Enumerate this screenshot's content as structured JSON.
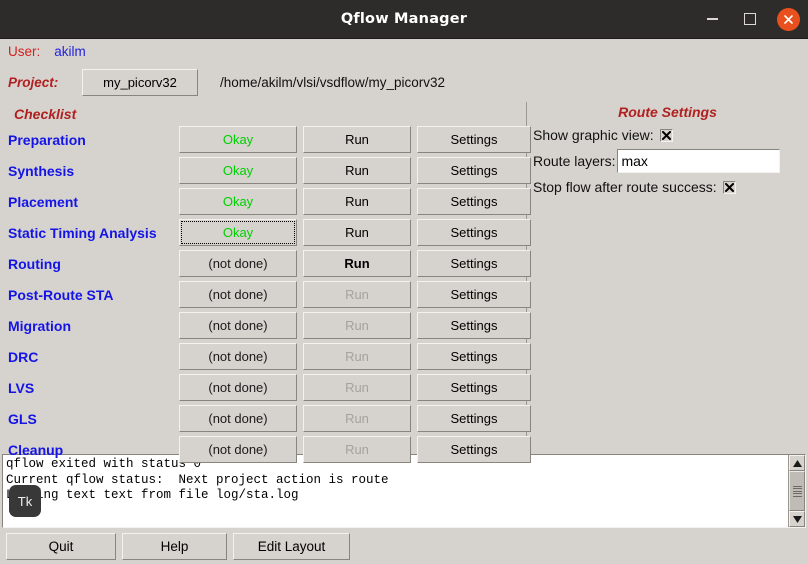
{
  "window": {
    "title": "Qflow Manager",
    "controls": {
      "minimize": "minimize-button",
      "maximize": "maximize-button",
      "close": "close-button"
    },
    "close_color": "#e8501d",
    "titlebar_color": "#2e2c2b"
  },
  "header": {
    "user_label": "User:",
    "user_value": "akilm",
    "project_label": "Project:",
    "project_button": "my_picorv32",
    "project_path": "/home/akilm/vlsi/vsdflow/my_picorv32"
  },
  "checklist": {
    "title": "Checklist",
    "run_label": "Run",
    "settings_label": "Settings",
    "status_okay": "Okay",
    "status_notdone": "(not done)",
    "okay_color": "#00d000",
    "label_color": "#1414e6",
    "rows": [
      {
        "label": "Preparation",
        "status": "Okay",
        "status_state": "okay",
        "run_state": "enabled",
        "settings_state": "enabled",
        "focused": false
      },
      {
        "label": "Synthesis",
        "status": "Okay",
        "status_state": "okay",
        "run_state": "enabled",
        "settings_state": "enabled",
        "focused": false
      },
      {
        "label": "Placement",
        "status": "Okay",
        "status_state": "okay",
        "run_state": "enabled",
        "settings_state": "enabled",
        "focused": false
      },
      {
        "label": "Static Timing Analysis",
        "status": "Okay",
        "status_state": "okay",
        "run_state": "enabled",
        "settings_state": "enabled",
        "focused": true
      },
      {
        "label": "Routing",
        "status": "(not done)",
        "status_state": "not-done",
        "run_state": "active",
        "settings_state": "enabled",
        "focused": false
      },
      {
        "label": "Post-Route STA",
        "status": "(not done)",
        "status_state": "not-done",
        "run_state": "disabled",
        "settings_state": "enabled",
        "focused": false
      },
      {
        "label": "Migration",
        "status": "(not done)",
        "status_state": "not-done",
        "run_state": "disabled",
        "settings_state": "enabled",
        "focused": false
      },
      {
        "label": "DRC",
        "status": "(not done)",
        "status_state": "not-done",
        "run_state": "disabled",
        "settings_state": "enabled",
        "focused": false
      },
      {
        "label": "LVS",
        "status": "(not done)",
        "status_state": "not-done",
        "run_state": "disabled",
        "settings_state": "enabled",
        "focused": false
      },
      {
        "label": "GLS",
        "status": "(not done)",
        "status_state": "not-done",
        "run_state": "disabled",
        "settings_state": "enabled",
        "focused": false
      },
      {
        "label": "Cleanup",
        "status": "(not done)",
        "status_state": "not-done",
        "run_state": "disabled",
        "settings_state": "enabled",
        "focused": false
      }
    ]
  },
  "overlay": {
    "tk_icon_label": "Tk"
  },
  "route_settings": {
    "title": "Route Settings",
    "show_graphic_view_label": "Show graphic view:",
    "show_graphic_view_checked": true,
    "route_layers_label": "Route layers:",
    "route_layers_value": "max",
    "route_layers_placeholder": "",
    "stop_flow_label": "Stop flow after route success:",
    "stop_flow_checked": true,
    "title_color": "#b02020"
  },
  "console": {
    "lines": [
      "qflow exited with status 0",
      "Current qflow status:  Next project action is route",
      "Loading text text from file log/sta.log"
    ],
    "text": "qflow exited with status 0\nCurrent qflow status:  Next project action is route\nLoading text text from file log/sta.log"
  },
  "footer": {
    "quit": "Quit",
    "help": "Help",
    "edit_layout": "Edit Layout"
  }
}
